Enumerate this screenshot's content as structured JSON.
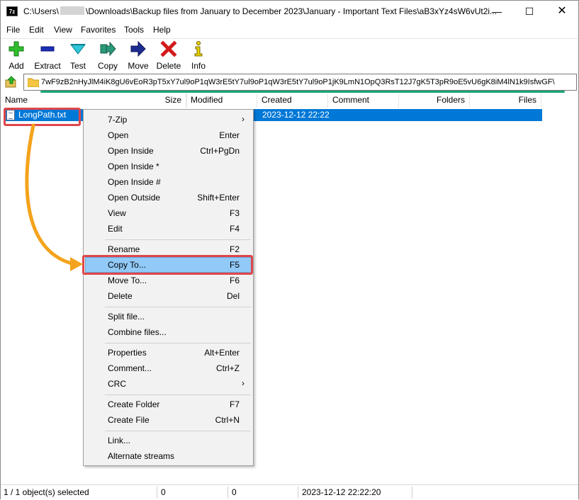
{
  "window": {
    "title_prefix": "C:\\Users\\",
    "title_suffix": "\\Downloads\\Backup files from January to December 2023\\January - Important Text Files\\aB3xYz4sW6vUt2i...",
    "min": "—",
    "max": "☐",
    "close": "✕",
    "app_icon_text": "7z"
  },
  "menubar": [
    "File",
    "Edit",
    "View",
    "Favorites",
    "Tools",
    "Help"
  ],
  "toolbar": {
    "add": "Add",
    "extract": "Extract",
    "test": "Test",
    "copy": "Copy",
    "move": "Move",
    "delete": "Delete",
    "info": "Info"
  },
  "address": {
    "path": "7wF9zB2nHyJlM4iK8gU6vEoR3pT5xY7ul9oP1qW3rE5tY7ul9oP1qW3rE5tY7ul9oP1jK9LmN1OpQ3RsT12J7gK5T3pR9oE5vU6gK8iM4lN1k9IsfwGF\\"
  },
  "columns": {
    "name": "Name",
    "size": "Size",
    "modified": "Modified",
    "created": "Created",
    "comment": "Comment",
    "folders": "Folders",
    "files": "Files"
  },
  "file_row": {
    "name": "LongPath.txt",
    "created": "2023-12-12 22:22"
  },
  "context_menu": [
    {
      "label": "7-Zip",
      "shortcut": "",
      "submenu": true
    },
    {
      "label": "Open",
      "shortcut": "Enter"
    },
    {
      "label": "Open Inside",
      "shortcut": "Ctrl+PgDn"
    },
    {
      "label": "Open Inside *",
      "shortcut": ""
    },
    {
      "label": "Open Inside #",
      "shortcut": ""
    },
    {
      "label": "Open Outside",
      "shortcut": "Shift+Enter"
    },
    {
      "label": "View",
      "shortcut": "F3"
    },
    {
      "label": "Edit",
      "shortcut": "F4"
    },
    {
      "label": "Rename",
      "shortcut": "F2"
    },
    {
      "label": "Copy To...",
      "shortcut": "F5"
    },
    {
      "label": "Move To...",
      "shortcut": "F6"
    },
    {
      "label": "Delete",
      "shortcut": "Del"
    },
    {
      "label": "Split file...",
      "shortcut": ""
    },
    {
      "label": "Combine files...",
      "shortcut": ""
    },
    {
      "label": "Properties",
      "shortcut": "Alt+Enter"
    },
    {
      "label": "Comment...",
      "shortcut": "Ctrl+Z"
    },
    {
      "label": "CRC",
      "shortcut": "",
      "submenu": true
    },
    {
      "label": "Create Folder",
      "shortcut": "F7"
    },
    {
      "label": "Create File",
      "shortcut": "Ctrl+N"
    },
    {
      "label": "Link...",
      "shortcut": ""
    },
    {
      "label": "Alternate streams",
      "shortcut": ""
    }
  ],
  "submenu_arrow": "›",
  "status": {
    "selected": "1 / 1 object(s) selected",
    "size1": "0",
    "size2": "0",
    "datetime": "2023-12-12 22:22:20"
  },
  "colors": {
    "selection": "#0078d7",
    "highlight_red": "#e0464b",
    "underline_green": "#19a673",
    "arrow_orange": "#f4a31c"
  }
}
